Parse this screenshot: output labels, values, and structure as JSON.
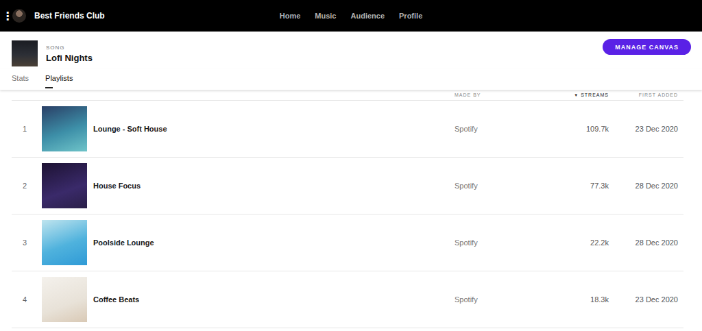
{
  "top_bar": {
    "menu_icon": "⋮",
    "artist": "Best Friends Club",
    "nav": [
      {
        "label": "Home",
        "selected": false
      },
      {
        "label": "Music",
        "selected": false
      },
      {
        "label": "Audience",
        "selected": false
      },
      {
        "label": "Profile",
        "selected": false
      }
    ]
  },
  "song": {
    "type_label": "SONG",
    "title": "Lofi Nights",
    "button": "MANAGE CANVAS"
  },
  "tabs": [
    {
      "label": "Stats",
      "selected": false
    },
    {
      "label": "Playlists",
      "selected": true
    }
  ],
  "table": {
    "sort_icon": "▼",
    "columns": [
      {
        "label": "MADE BY",
        "sorted": false
      },
      {
        "label": "STREAMS",
        "sorted": true
      },
      {
        "label": "FIRST ADDED",
        "sorted": false
      }
    ],
    "rows": [
      {
        "index": "1",
        "name": "Lounge - Soft House",
        "made_by": "Spotify",
        "streams": "109.7k",
        "first_added": "23 Dec 2020"
      },
      {
        "index": "2",
        "name": "House Focus",
        "made_by": "Spotify",
        "streams": "77.3k",
        "first_added": "28 Dec 2020"
      },
      {
        "index": "3",
        "name": "Poolside Lounge",
        "made_by": "Spotify",
        "streams": "22.2k",
        "first_added": "28 Dec 2020"
      },
      {
        "index": "4",
        "name": "Coffee Beats",
        "made_by": "Spotify",
        "streams": "18.3k",
        "first_added": "23 Dec 2020"
      }
    ]
  }
}
